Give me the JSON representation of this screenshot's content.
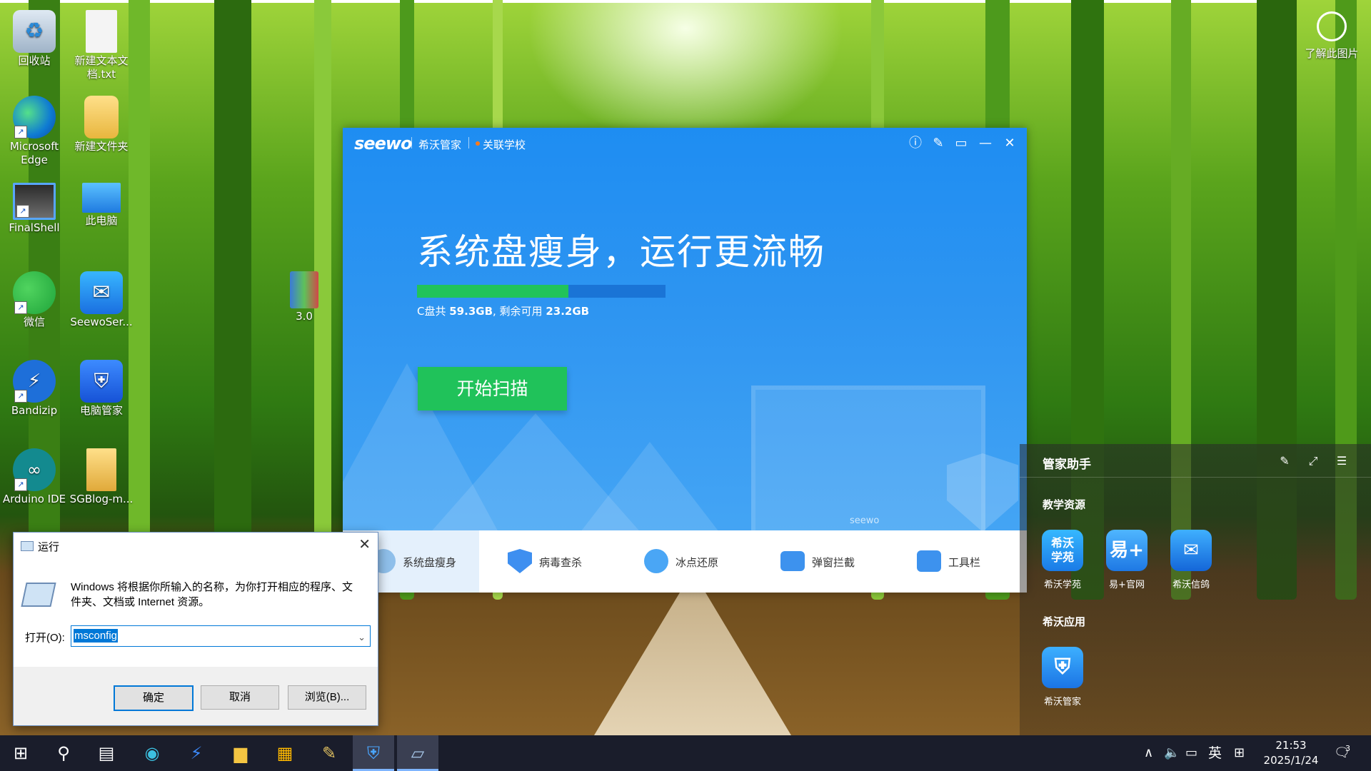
{
  "colors": {
    "seewo_blue": "#1e8df2",
    "scan_green": "#20c25a",
    "taskbar": "#1a1d2b",
    "run_accent": "#0078d7"
  },
  "desktop": {
    "icons": [
      {
        "name": "recycle-bin-icon",
        "label": "回收站"
      },
      {
        "name": "new-text-file-icon",
        "label": "新建文本文\n档.txt"
      },
      {
        "name": "edge-icon",
        "label": "Microsoft\nEdge"
      },
      {
        "name": "new-folder-icon",
        "label": "新建文件夹"
      },
      {
        "name": "finalshell-icon",
        "label": "FinalShell"
      },
      {
        "name": "this-pc-icon",
        "label": "此电脑"
      },
      {
        "name": "wechat-icon",
        "label": "微信"
      },
      {
        "name": "seewoservice-icon",
        "label": "SeewoSer..."
      },
      {
        "name": "archive-3-0-icon",
        "label": "3.0"
      },
      {
        "name": "bandizip-icon",
        "label": "Bandizip"
      },
      {
        "name": "pc-manager-icon",
        "label": "电脑管家"
      },
      {
        "name": "arduino-ide-icon",
        "label": "Arduino IDE"
      },
      {
        "name": "sgblog-folder-icon",
        "label": "SGBlog-m..."
      }
    ],
    "learn_picture": "了解此图片"
  },
  "seewo": {
    "logo": "seewo",
    "app_name": "希沃管家",
    "school_link": "关联学校",
    "headline": "系统盘瘦身，运行更流畅",
    "disk_prefix": "C盘共 ",
    "disk_total": "59.3GB",
    "disk_mid": ", 剩余可用 ",
    "disk_free": "23.2GB",
    "disk_used_fraction": 0.61,
    "scan_button": "开始扫描",
    "monitor_label": "seewo",
    "tabs": [
      {
        "name": "tab-disk-slim",
        "label": "系统盘瘦身",
        "icon": "disk-slim-icon"
      },
      {
        "name": "tab-antivirus",
        "label": "病毒查杀",
        "icon": "shield-lightning-icon"
      },
      {
        "name": "tab-freeze-restore",
        "label": "冰点还原",
        "icon": "snowflake-icon"
      },
      {
        "name": "tab-popup-block",
        "label": "弹窗拦截",
        "icon": "popup-block-icon"
      },
      {
        "name": "tab-toolbox",
        "label": "工具栏",
        "icon": "toolbox-icon"
      }
    ]
  },
  "assistant": {
    "title": "管家助手",
    "section_resources": "教学资源",
    "resources": [
      {
        "name": "seewo-academy-icon",
        "label": "希沃学苑",
        "glyph": "希沃\n学苑"
      },
      {
        "name": "yi-plus-icon",
        "label": "易+官网",
        "glyph": "易+"
      },
      {
        "name": "seewo-xinge-icon",
        "label": "希沃信鸽",
        "glyph": "✉"
      }
    ],
    "section_apps": "希沃应用",
    "apps": [
      {
        "name": "seewo-manager-app-icon",
        "label": "希沃管家",
        "glyph": "⛨"
      }
    ]
  },
  "run_dialog": {
    "title": "运行",
    "description": "Windows 将根据你所输入的名称，为你打开相应的程序、文件夹、文档或 Internet 资源。",
    "open_label": "打开(O):",
    "input_value": "msconfig",
    "ok": "确定",
    "cancel": "取消",
    "browse": "浏览(B)..."
  },
  "taskbar": {
    "ime": "英",
    "clock_time": "21:53",
    "clock_date": "2025/1/24",
    "notification_count": "3"
  }
}
